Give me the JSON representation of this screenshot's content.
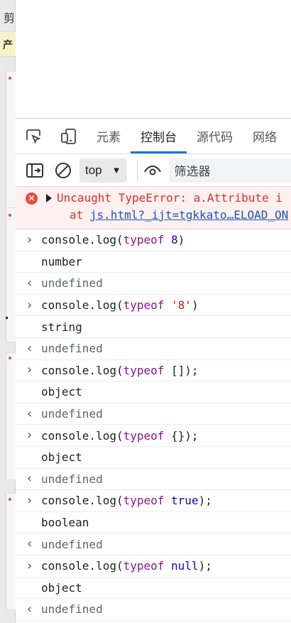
{
  "background": {
    "cut_char": "剪",
    "banner_char": "产"
  },
  "devtools": {
    "tabs": [
      "元素",
      "控制台",
      "源代码",
      "网络"
    ],
    "active_tab": "控制台",
    "toolbar": {
      "context": "top",
      "filter_placeholder": "筛选器"
    },
    "error": {
      "message": "Uncaught TypeError: a.Attribute i",
      "at_prefix": "at",
      "at_link": "js.html?_ijt=tgkkato…ELOAD_ON"
    },
    "entries": [
      {
        "type": "input",
        "parts": [
          [
            "console.log(",
            ""
          ],
          [
            "typeof",
            "kw"
          ],
          [
            " ",
            ""
          ],
          [
            "8",
            "num"
          ],
          [
            ")",
            ""
          ]
        ]
      },
      {
        "type": "output",
        "text": "number"
      },
      {
        "type": "result",
        "text": "undefined"
      },
      {
        "type": "input",
        "parts": [
          [
            "console.log(",
            ""
          ],
          [
            "typeof",
            "kw"
          ],
          [
            " ",
            ""
          ],
          [
            "'8'",
            "str"
          ],
          [
            ")",
            ""
          ]
        ]
      },
      {
        "type": "output",
        "text": "string"
      },
      {
        "type": "result",
        "text": "undefined"
      },
      {
        "type": "input",
        "parts": [
          [
            "console.log(",
            ""
          ],
          [
            "typeof",
            "kw"
          ],
          [
            " []);",
            ""
          ]
        ]
      },
      {
        "type": "output",
        "text": "object"
      },
      {
        "type": "result",
        "text": "undefined"
      },
      {
        "type": "input",
        "parts": [
          [
            "console.log(",
            ""
          ],
          [
            "typeof",
            "kw"
          ],
          [
            " {});",
            ""
          ]
        ]
      },
      {
        "type": "output",
        "text": "object"
      },
      {
        "type": "result",
        "text": "undefined"
      },
      {
        "type": "input",
        "parts": [
          [
            "console.log(",
            ""
          ],
          [
            "typeof",
            "kw"
          ],
          [
            " ",
            ""
          ],
          [
            "true",
            "lit"
          ],
          [
            ");",
            ""
          ]
        ]
      },
      {
        "type": "output",
        "text": "boolean"
      },
      {
        "type": "result",
        "text": "undefined"
      },
      {
        "type": "input",
        "parts": [
          [
            "console.log(",
            ""
          ],
          [
            "typeof",
            "kw"
          ],
          [
            " ",
            ""
          ],
          [
            "null",
            "lit"
          ],
          [
            ");",
            ""
          ]
        ]
      },
      {
        "type": "output",
        "text": "object"
      },
      {
        "type": "result",
        "text": "undefined"
      }
    ]
  },
  "colors": {
    "accent": "#1a73e8",
    "error_bg": "#fff0f0",
    "error_text": "#d93025",
    "keyword": "#881391",
    "number": "#1c00cf",
    "string": "#c41a16"
  }
}
